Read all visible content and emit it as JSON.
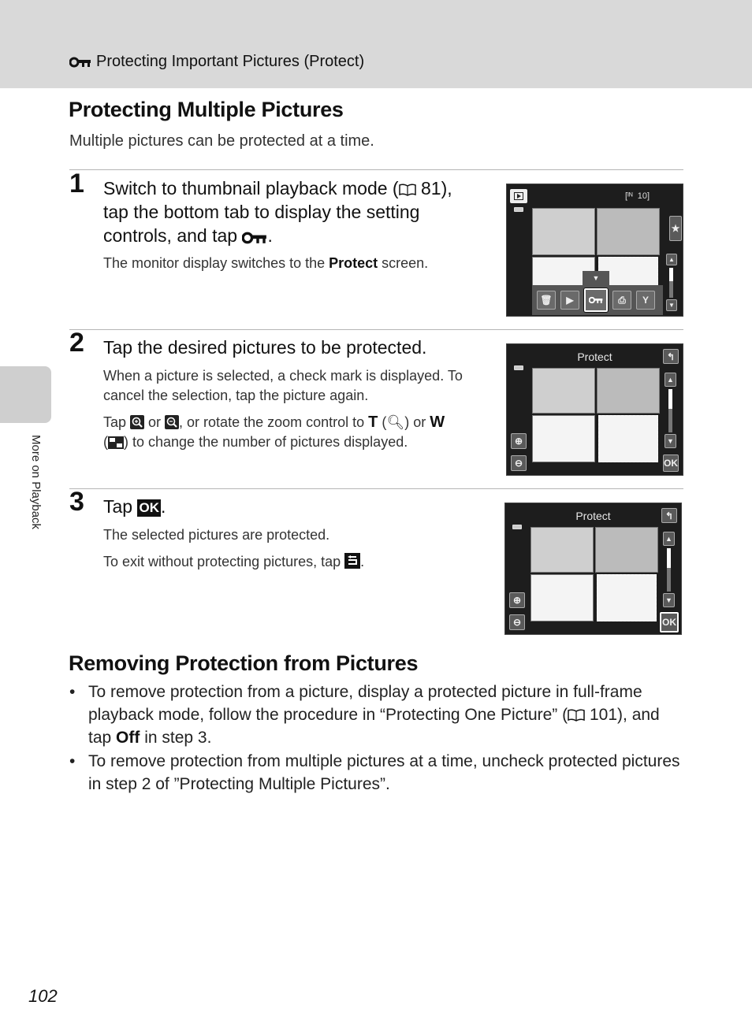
{
  "header": {
    "icon": "key-protect-icon",
    "title": "Protecting Important Pictures (Protect)"
  },
  "section1": {
    "title": "Protecting Multiple Pictures",
    "intro": "Multiple pictures can be protected at a time."
  },
  "steps": [
    {
      "number": "1",
      "title_a": "Switch to thumbnail playback mode (",
      "title_ref": "81",
      "title_b": "), tap the bottom tab to display the setting controls, and tap ",
      "title_end": ".",
      "body_a": "The monitor display switches to the ",
      "body_bold": "Protect",
      "body_b": " screen.",
      "screen": {
        "frame_counter": "10",
        "memory_icon": "internal-memory-icon",
        "toolbar": [
          "delete-icon",
          "slideshow-icon",
          "protect-key-icon",
          "print-order-icon",
          "setup-wrench-icon"
        ],
        "selected_tool": "protect-key-icon",
        "scroll_fraction": 0.55
      }
    },
    {
      "number": "2",
      "title": "Tap the desired pictures to be protected.",
      "body1": "When a picture is selected, a check mark is displayed. To cancel the selection, tap the picture again.",
      "body2_a": "Tap ",
      "body2_b": " or ",
      "body2_c": ", or rotate the zoom control to ",
      "body2_T": "T",
      "body2_d": " (",
      "body2_e": ") or ",
      "body2_W": "W",
      "body2_f": " (",
      "body2_g": ") to change the number of pictures displayed.",
      "screen": {
        "title": "Protect",
        "ok_label": "OK",
        "scroll_fraction": 0.55
      }
    },
    {
      "number": "3",
      "title_a": "Tap ",
      "title_ok": "OK",
      "title_end": ".",
      "body1": "The selected pictures are protected.",
      "body2_a": "To exit without protecting pictures, tap ",
      "body2_end": ".",
      "screen": {
        "title": "Protect",
        "ok_label": "OK",
        "scroll_fraction": 0.55
      }
    }
  ],
  "section2": {
    "title": "Removing Protection from Pictures",
    "bullet1_a": "To remove protection from a picture, display a protected picture in full-frame playback mode, follow the procedure in “Protecting One Picture” (",
    "bullet1_ref": "101",
    "bullet1_b": "), and tap ",
    "bullet1_bold": "Off",
    "bullet1_c": " in step 3.",
    "bullet2": "To remove protection from multiple pictures at a time, uncheck protected pictures in step 2 of ”Protecting Multiple Pictures”."
  },
  "side_tab": {
    "label": "More on Playback"
  },
  "page_number": "102"
}
